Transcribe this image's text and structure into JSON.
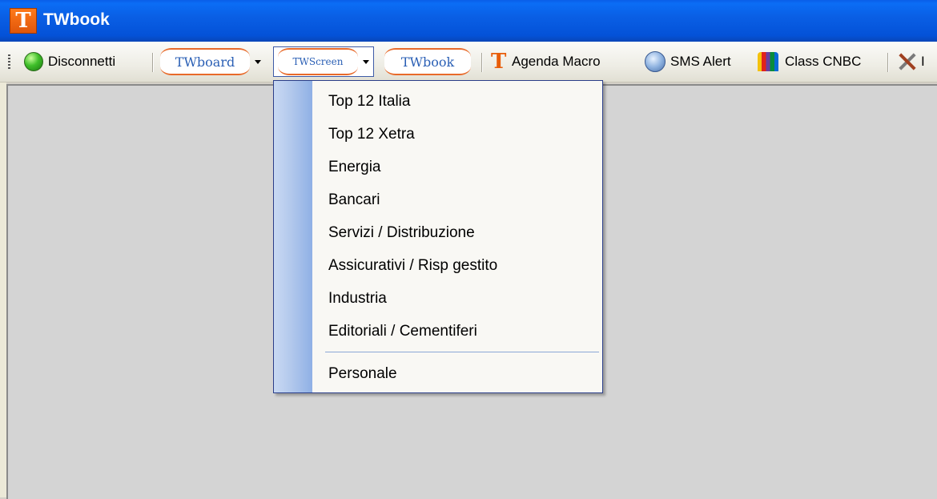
{
  "window": {
    "title": "TWbook",
    "logo_letter": "T"
  },
  "toolbar": {
    "disconnect_label": "Disconnetti",
    "twboard_label": "TWboard",
    "twscreen_label": "TWScreen",
    "twbook_label": "TWbook",
    "agenda_label": "Agenda Macro",
    "agenda_icon_letter": "T",
    "sms_label": "SMS Alert",
    "cnbc_label": "Class CNBC",
    "last_label": "I"
  },
  "menu": {
    "items": [
      "Top 12 Italia",
      "Top 12 Xetra",
      "Energia",
      "Bancari",
      "Servizi / Distribuzione",
      "Assicurativi / Risp gestito",
      "Industria",
      "Editoriali / Cementiferi"
    ],
    "footer_item": "Personale"
  },
  "colors": {
    "titlebar": "#0a5ee8",
    "workspace": "#d4d4d4",
    "menu_gutter": "#b2c8ec",
    "accent_orange": "#e85d0a"
  }
}
